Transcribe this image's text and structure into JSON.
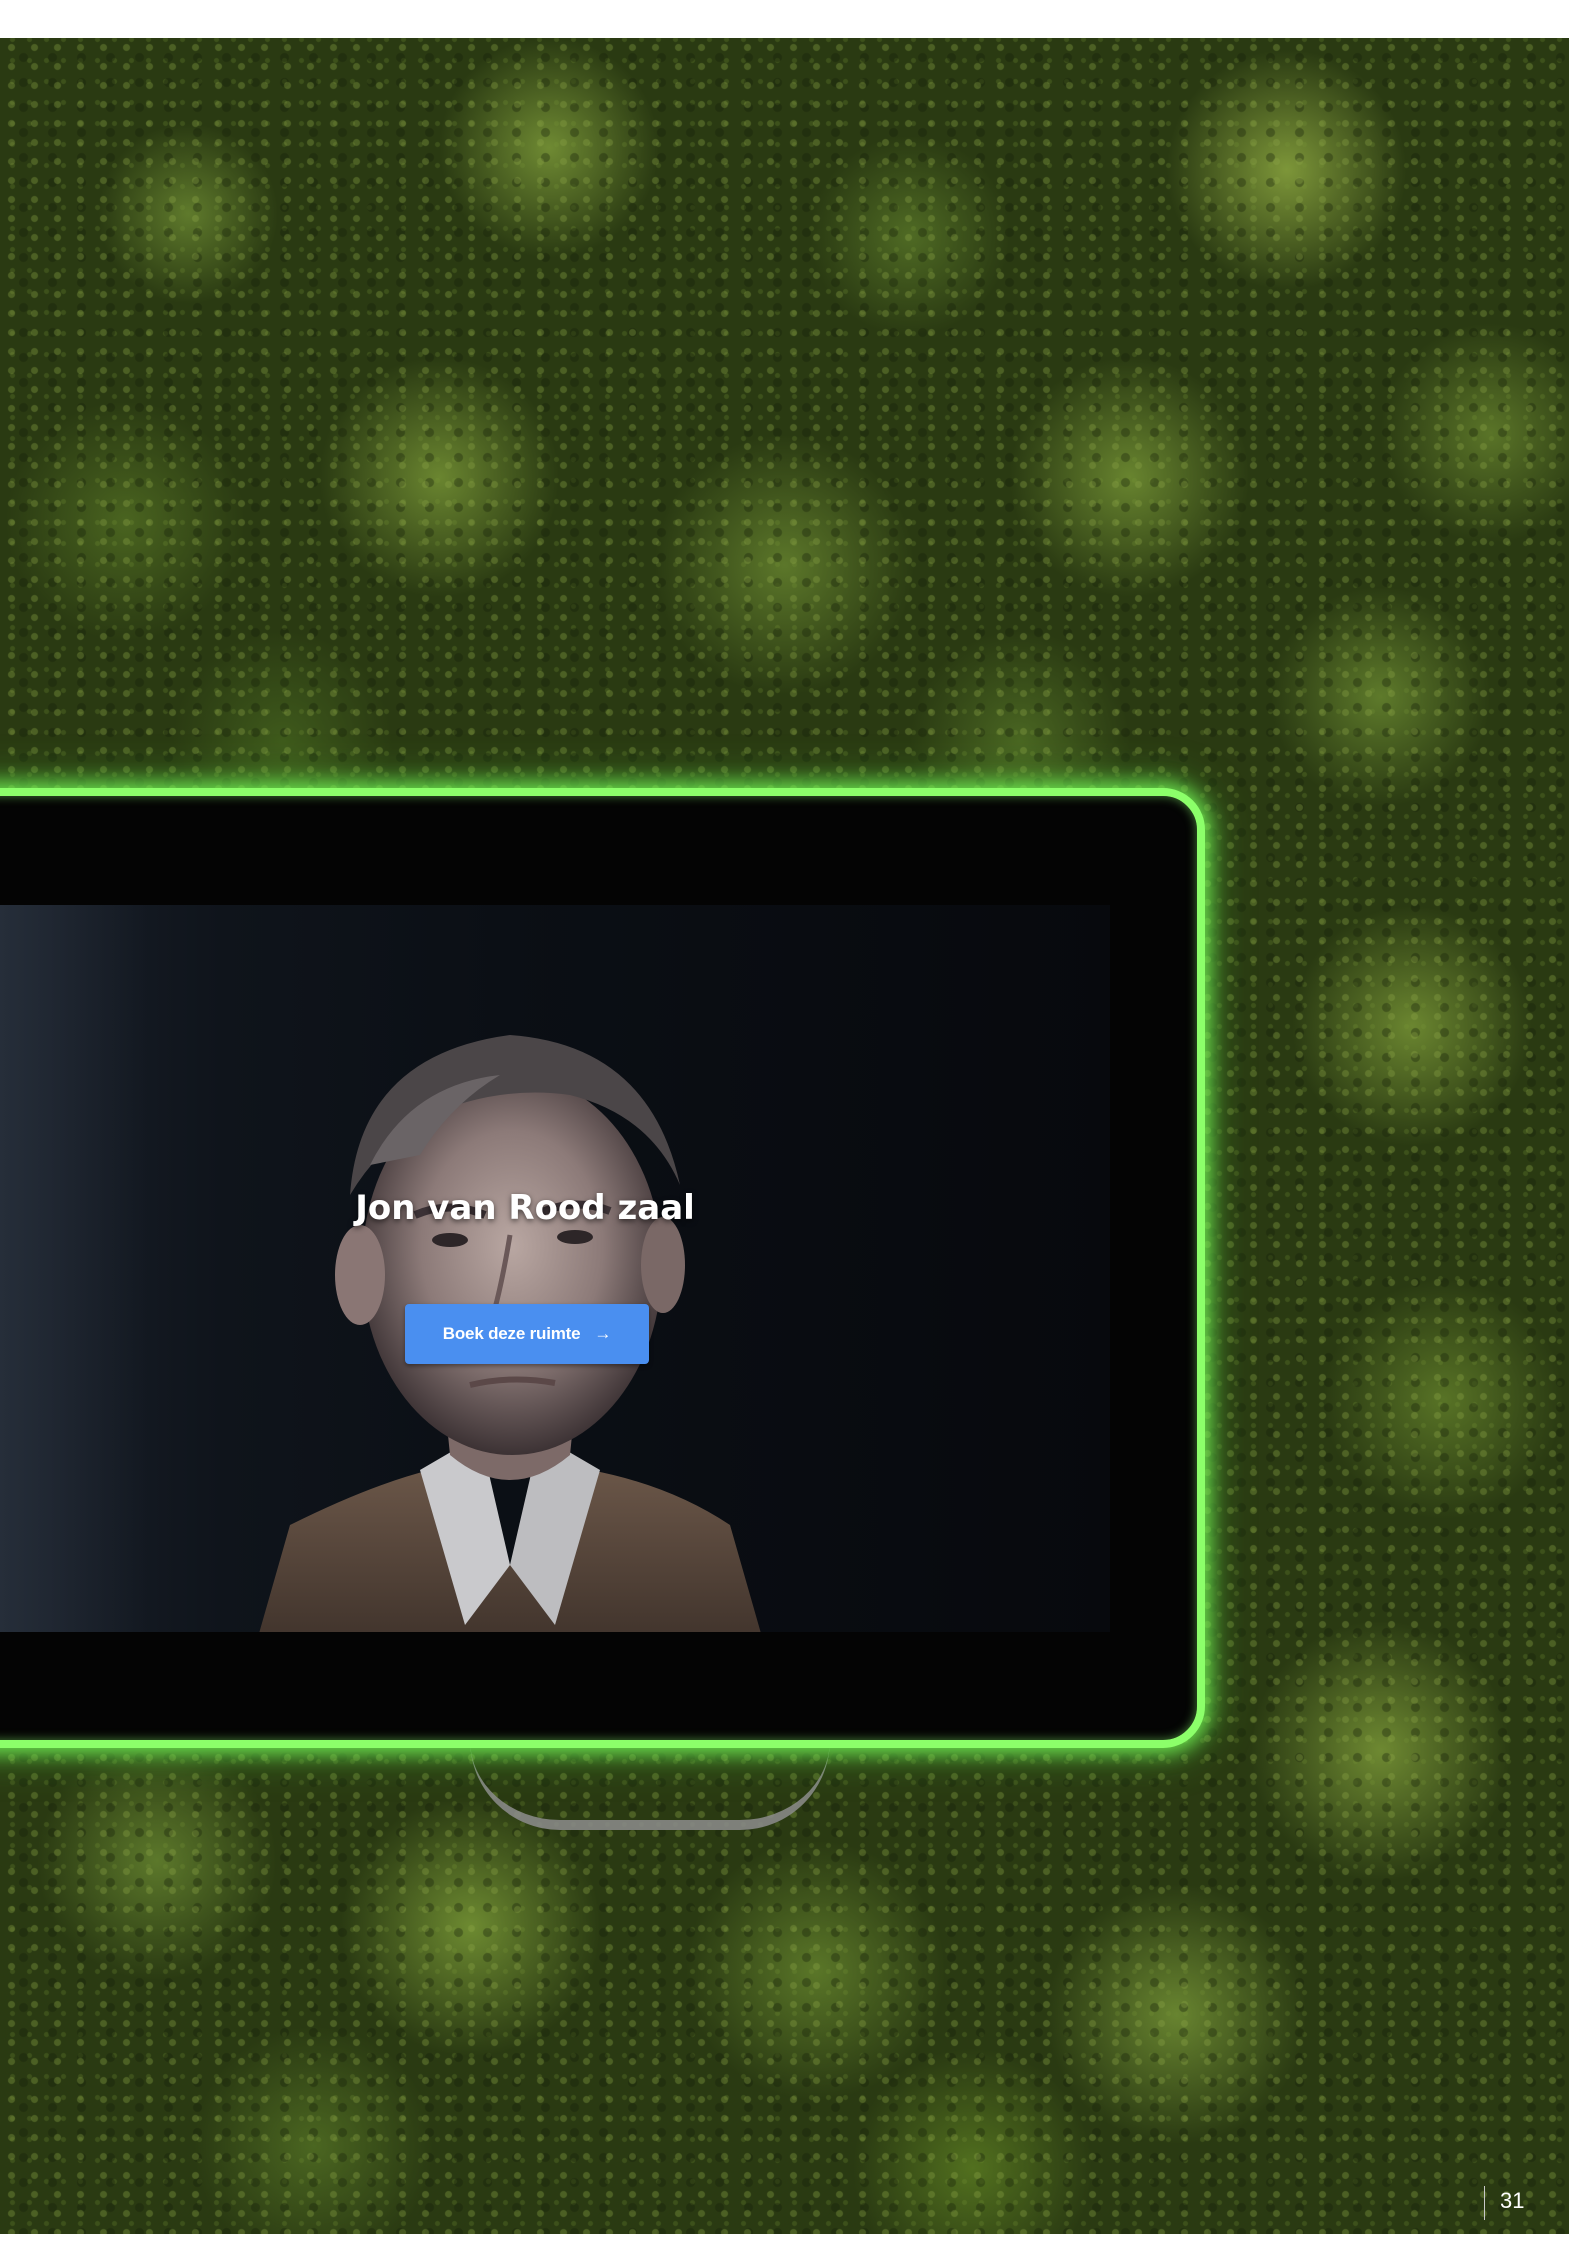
{
  "screen": {
    "room_title": "Jon van Rood zaal",
    "book_button_label": "Boek deze ruimte",
    "book_button_icon": "arrow-right-icon"
  },
  "page": {
    "number": "31"
  },
  "colors": {
    "glow_border": "#8cff6a",
    "button": "#4a8ff0",
    "moss": "#4f6a24"
  }
}
